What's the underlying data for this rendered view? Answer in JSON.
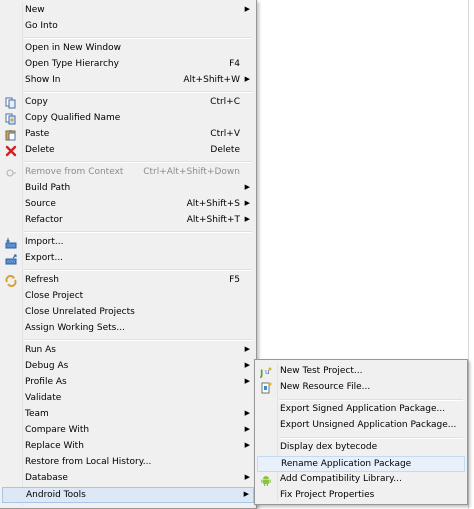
{
  "main_menu": {
    "items": [
      {
        "label": "New",
        "accel": "",
        "arrow": "▶"
      },
      {
        "label": "Go Into",
        "accel": ""
      },
      {
        "label": "Open in New Window",
        "accel": ""
      },
      {
        "label": "Open Type Hierarchy",
        "accel": "F4"
      },
      {
        "label": "Show In",
        "accel": "Alt+Shift+W",
        "arrow": "▶"
      },
      {
        "label": "Copy",
        "accel": "Ctrl+C",
        "icon": "copy-icon"
      },
      {
        "label": "Copy Qualified Name",
        "accel": "",
        "icon": "copy-qualified-icon"
      },
      {
        "label": "Paste",
        "accel": "Ctrl+V",
        "icon": "paste-icon"
      },
      {
        "label": "Delete",
        "accel": "Delete",
        "icon": "delete-icon"
      },
      {
        "label": "Remove from Context",
        "accel": "Ctrl+Alt+Shift+Down",
        "icon": "remove-context-icon"
      },
      {
        "label": "Build Path",
        "accel": "",
        "arrow": "▶"
      },
      {
        "label": "Source",
        "accel": "Alt+Shift+S",
        "arrow": "▶"
      },
      {
        "label": "Refactor",
        "accel": "Alt+Shift+T",
        "arrow": "▶"
      },
      {
        "label": "Import...",
        "accel": "",
        "icon": "import-icon"
      },
      {
        "label": "Export...",
        "accel": "",
        "icon": "export-icon"
      },
      {
        "label": "Refresh",
        "accel": "F5",
        "icon": "refresh-icon"
      },
      {
        "label": "Close Project",
        "accel": ""
      },
      {
        "label": "Close Unrelated Projects",
        "accel": ""
      },
      {
        "label": "Assign Working Sets...",
        "accel": ""
      },
      {
        "label": "Run As",
        "accel": "",
        "arrow": "▶"
      },
      {
        "label": "Debug As",
        "accel": "",
        "arrow": "▶"
      },
      {
        "label": "Profile As",
        "accel": "",
        "arrow": "▶"
      },
      {
        "label": "Validate",
        "accel": ""
      },
      {
        "label": "Team",
        "accel": "",
        "arrow": "▶"
      },
      {
        "label": "Compare With",
        "accel": "",
        "arrow": "▶"
      },
      {
        "label": "Replace With",
        "accel": "",
        "arrow": "▶"
      },
      {
        "label": "Restore from Local History...",
        "accel": ""
      },
      {
        "label": "Database",
        "accel": "",
        "arrow": "▶"
      },
      {
        "label": "Android Tools",
        "accel": "",
        "arrow": "▶"
      }
    ]
  },
  "sub_menu": {
    "items": [
      {
        "label": "New Test Project...",
        "icon": "new-test-project-icon"
      },
      {
        "label": "New Resource File...",
        "icon": "new-resource-file-icon"
      },
      {
        "label": "Export Signed Application Package..."
      },
      {
        "label": "Export Unsigned Application Package..."
      },
      {
        "label": "Display dex bytecode"
      },
      {
        "label": "Rename Application Package"
      },
      {
        "label": "Add Compatibility Library...",
        "icon": "android-icon"
      },
      {
        "label": "Fix Project Properties"
      }
    ]
  }
}
